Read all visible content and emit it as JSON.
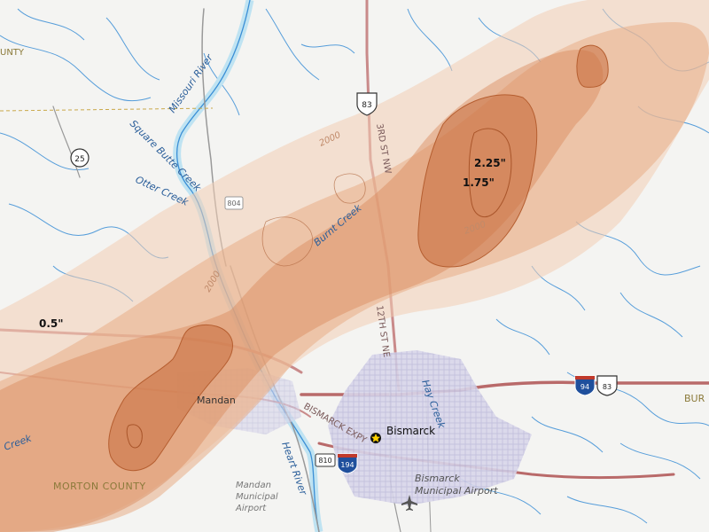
{
  "map": {
    "colors": {
      "background": "#f4f4f2",
      "water": "#3b8fd6",
      "river_fill": "#bfe3f2",
      "road": "#c98a8a",
      "road_major": "#b96a6a",
      "contour_outer": "#f3cdb5",
      "contour_mid": "#e3a07a",
      "contour_inner": "#c9703f",
      "urban": "#c6c6e2",
      "county_text": "#8b7a3a"
    },
    "contour_labels": [
      "0.5\"",
      "1.75\"",
      "2.25\""
    ],
    "elevation_labels": [
      "2000",
      "2000",
      "2000"
    ],
    "places": {
      "city": "Bismarck",
      "town": "Mandan",
      "airport": "Bismarck Municipal Airport",
      "airport_line1": "Bismarck",
      "airport_line2": "Municipal Airport",
      "mandan_airport_line1": "Mandan",
      "mandan_airport_line2": "Municipal",
      "mandan_airport_line3": "Airport"
    },
    "counties": {
      "morton": "MORTON COUNTY",
      "burleigh_partial": "BUR",
      "left_partial": "UNTY"
    },
    "water_labels": {
      "missouri": "Missouri River",
      "square_butte": "Square Butte Creek",
      "otter": "Otter Creek",
      "burnt": "Burnt Creek",
      "hay": "Hay Creek",
      "heart": "Heart River",
      "creek_left": "Creek"
    },
    "roads": {
      "third_st": "3RD ST NW",
      "twelfth_st": "12TH ST NE",
      "expressway": "BISMARCK EXPY",
      "shield_us83": "83",
      "shield_nd25": "25",
      "shield_804": "804",
      "shield_810": "810",
      "shield_i94": "94",
      "shield_i194": "194",
      "shield_us83b": "83"
    }
  }
}
